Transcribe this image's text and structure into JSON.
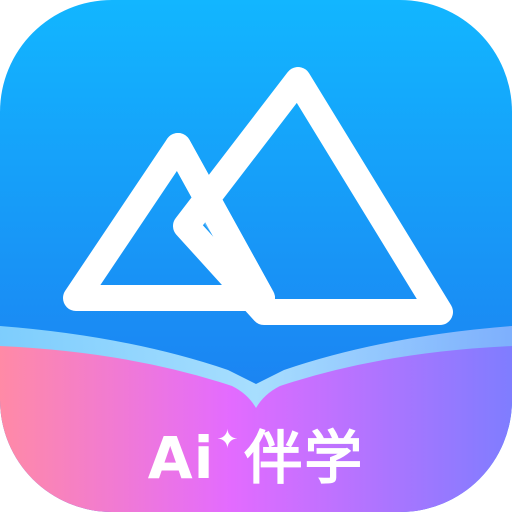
{
  "app_icon": {
    "badge_text_latin": "Ai",
    "badge_text_cjk": "伴学",
    "spark_glyph": "✦",
    "logo_icon": "mountain-peaks-icon",
    "colors": {
      "sky_top": "#12b6ff",
      "sky_bottom": "#1e74ee",
      "banner_left": "#ff8aa6",
      "banner_mid": "#e36bff",
      "banner_right": "#7f7dff",
      "peaks": "#ffffff"
    }
  }
}
